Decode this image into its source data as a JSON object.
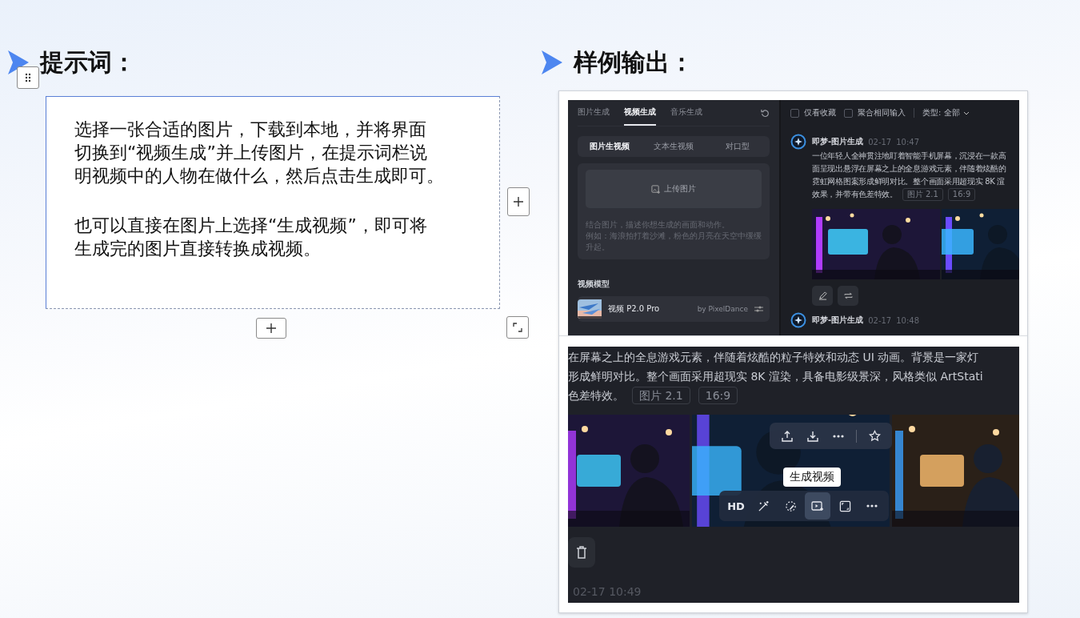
{
  "prompt_panel": {
    "title": "提示词：",
    "paragraphs": [
      {
        "lines": [
          "选择一张合适的图片，下载到本地，并将界面",
          "切换到“视频生成”并上传图片，在提示词栏说",
          "明视频中的人物在做什么，然后点击生成即可。"
        ]
      },
      {
        "lines": [
          "也可以直接在图片上选择“生成视频”，即可将",
          "生成完的图片直接转换成视频。"
        ]
      }
    ]
  },
  "output_panel": {
    "title": "样例输出：",
    "top_screenshot": {
      "tabs": [
        {
          "label": "图片生成",
          "selected": false
        },
        {
          "label": "视频生成",
          "selected": true
        },
        {
          "label": "音乐生成",
          "selected": false
        }
      ],
      "modes": [
        {
          "label": "图片生视频",
          "selected": true
        },
        {
          "label": "文本生视频",
          "selected": false
        },
        {
          "label": "对口型",
          "selected": false
        }
      ],
      "upload_label": "上传图片",
      "placeholder_lines": [
        "结合图片，描述你想生成的画面和动作。",
        "例如：海浪拍打着沙滩，粉色的月亮在天空中缓缓升起。"
      ],
      "model_heading": "视频模型",
      "model": {
        "name": "视频 P2.0 Pro",
        "provider": "by PixelDance"
      },
      "filters": [
        {
          "label": "仅看收藏",
          "checked": false
        },
        {
          "label": "聚合相同输入",
          "checked": false
        }
      ],
      "type_filter": "类型: 全部",
      "messages": [
        {
          "sender": "即梦-图片生成",
          "date": "02-17",
          "time": "10:47",
          "lines": [
            "一位年轻人全神贯注地盯着智能手机屏幕，沉浸在一款高",
            "面呈现出悬浮在屏幕之上的全息游戏元素，伴随着炫酷的",
            "霓虹网格图案形成鲜明对比。整个画面采用超现实 8K 渲",
            "效果，并带有色差特效。"
          ],
          "tags": [
            "图片 2.1",
            "16:9"
          ]
        },
        {
          "sender": "即梦-图片生成",
          "date": "02-17",
          "time": "10:48"
        }
      ]
    },
    "bottom_screenshot": {
      "lines": [
        "在屏幕之上的全息游戏元素，伴随着炫酷的粒子特效和动态 UI 动画。背景是一家灯",
        "形成鲜明对比。整个画面采用超现实 8K 渲染，具备电影级景深，风格类似 ArtStati",
        "色差特效。"
      ],
      "tags": [
        "图片 2.1",
        "16:9"
      ],
      "tooltip": "生成视频",
      "image_tools": [
        {
          "kind": "hd",
          "label": "HD",
          "selected": false
        },
        {
          "kind": "wand",
          "selected": false
        },
        {
          "kind": "brush",
          "selected": false
        },
        {
          "kind": "video",
          "selected": true
        },
        {
          "kind": "expand",
          "selected": false
        },
        {
          "kind": "more",
          "selected": false
        }
      ],
      "timestamp": "02-17  10:49"
    }
  }
}
